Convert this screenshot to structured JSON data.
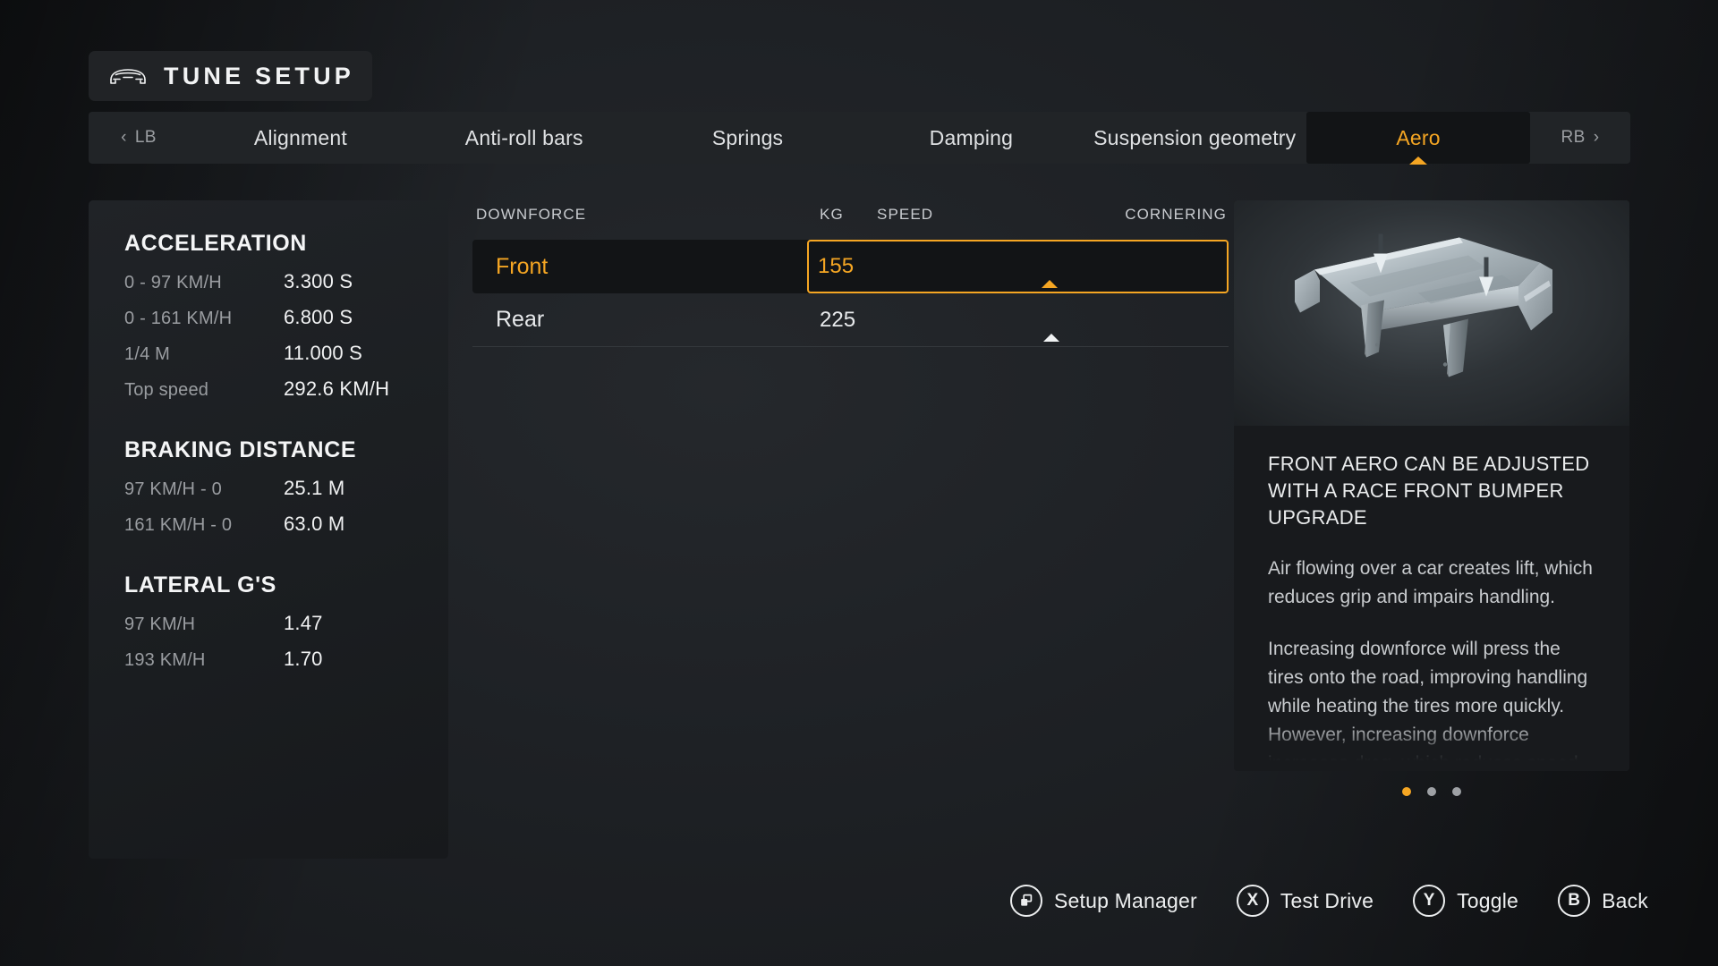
{
  "header": {
    "title": "TUNE SETUP",
    "icon": "car-front-icon"
  },
  "tabbar": {
    "prev_bumper": "LB",
    "next_bumper": "RB",
    "tabs": [
      {
        "label": "Alignment",
        "active": false
      },
      {
        "label": "Anti-roll bars",
        "active": false
      },
      {
        "label": "Springs",
        "active": false
      },
      {
        "label": "Damping",
        "active": false
      },
      {
        "label": "Suspension geometry",
        "active": false
      },
      {
        "label": "Aero",
        "active": true
      }
    ]
  },
  "stats": {
    "sections": [
      {
        "heading": "ACCELERATION",
        "rows": [
          {
            "label": "0 - 97 KM/H",
            "value": "3.300 S"
          },
          {
            "label": "0 - 161 KM/H",
            "value": "6.800 S"
          },
          {
            "label": "1/4 M",
            "value": "11.000 S"
          },
          {
            "label": "Top speed",
            "value": "292.6 KM/H"
          }
        ]
      },
      {
        "heading": "BRAKING DISTANCE",
        "rows": [
          {
            "label": "97 KM/H - 0",
            "value": "25.1 M"
          },
          {
            "label": "161 KM/H - 0",
            "value": "63.0 M"
          }
        ]
      },
      {
        "heading": "LATERAL G'S",
        "rows": [
          {
            "label": "97 KM/H",
            "value": "1.47"
          },
          {
            "label": "193 KM/H",
            "value": "1.70"
          }
        ]
      }
    ]
  },
  "settings": {
    "columns": {
      "name": "DOWNFORCE",
      "unit": "KG",
      "left_axis": "SPEED",
      "right_axis": "CORNERING"
    },
    "rows": [
      {
        "name": "Front",
        "value": "155",
        "fill_percent": 51,
        "selected": true
      },
      {
        "name": "Rear",
        "value": "225",
        "fill_percent": 51,
        "selected": false
      }
    ]
  },
  "info": {
    "part_icon": "rear-wing-3d-render",
    "title": "FRONT AERO CAN BE ADJUSTED WITH A RACE FRONT BUMPER UPGRADE",
    "paragraph_1": "Air flowing over a car creates lift, which reduces grip and impairs handling.",
    "paragraph_2": "Increasing downforce will press the tires onto the road, improving handling while heating the tires more quickly. However, increasing downforce increases drag, which reduces speed.",
    "pager": {
      "count": 3,
      "active_index": 0
    }
  },
  "actions": [
    {
      "glyph": "view-windows-icon",
      "label": "Setup Manager"
    },
    {
      "glyph": "X",
      "label": "Test Drive"
    },
    {
      "glyph": "Y",
      "label": "Toggle"
    },
    {
      "glyph": "B",
      "label": "Back"
    }
  ],
  "colors": {
    "accent": "#f5a623",
    "text_primary": "#f1f2f3",
    "text_muted": "#9a9da1",
    "panel": "#1b1e21",
    "track": "#5b6065"
  }
}
